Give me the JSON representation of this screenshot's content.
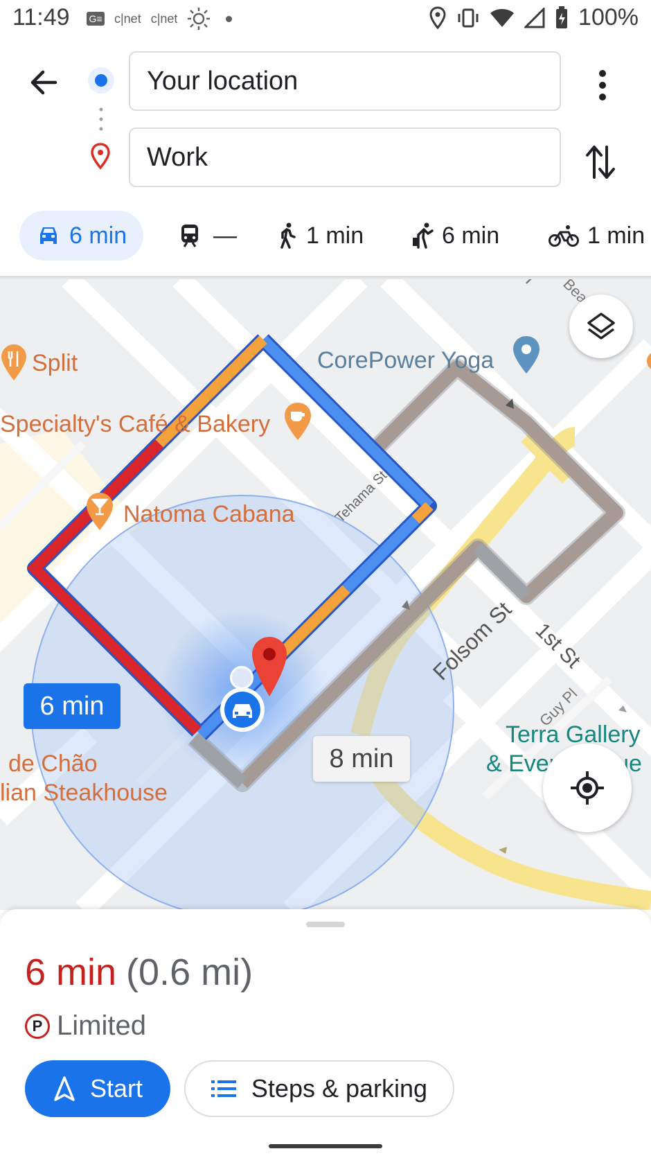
{
  "status_bar": {
    "time": "11:49",
    "icons_left": [
      "ge-icon",
      "cnet-icon",
      "cnet-icon",
      "brightness-icon",
      "dot-icon"
    ],
    "cnet_label_1": "c|net",
    "cnet_label_2": "c|net",
    "battery": "100%"
  },
  "route": {
    "origin_value": "Your location",
    "destination_value": "Work"
  },
  "modes": [
    {
      "icon": "car-icon",
      "label": "6 min",
      "active": true
    },
    {
      "icon": "transit-icon",
      "label": "—",
      "active": false
    },
    {
      "icon": "walk-icon",
      "label": "1 min",
      "active": false
    },
    {
      "icon": "rideshare-icon",
      "label": "6 min",
      "active": false
    },
    {
      "icon": "bike-icon",
      "label": "1 min",
      "active": false
    }
  ],
  "map": {
    "places": {
      "split": "Split",
      "specialty": "Specialty's Café & Bakery",
      "corepower": "CorePower Yoga",
      "natoma": "Natoma Cabana",
      "terra_line1": "Terra Gallery",
      "terra_line2": "& Event Venue",
      "fogo_line1": "de Chão",
      "fogo_line2": "lian Steakhouse"
    },
    "streets": {
      "tehama": "Tehama St",
      "folsom": "Folsom St",
      "first": "1st St",
      "guy": "Guy Pl",
      "beale": "Beale",
      "h": "H"
    },
    "route_bubbles": {
      "primary": "6 min",
      "alternate": "8 min"
    },
    "colors": {
      "route_blue": "#4d8ef1",
      "route_orange": "#f4a23b",
      "route_red": "#d9262c",
      "alt_route": "#a79a95",
      "accent": "#1a73e8"
    }
  },
  "sheet": {
    "duration": "6 min",
    "distance": "(0.6 mi)",
    "parking_label": "Limited",
    "parking_badge": "P",
    "start_label": "Start",
    "steps_label": "Steps & parking"
  }
}
